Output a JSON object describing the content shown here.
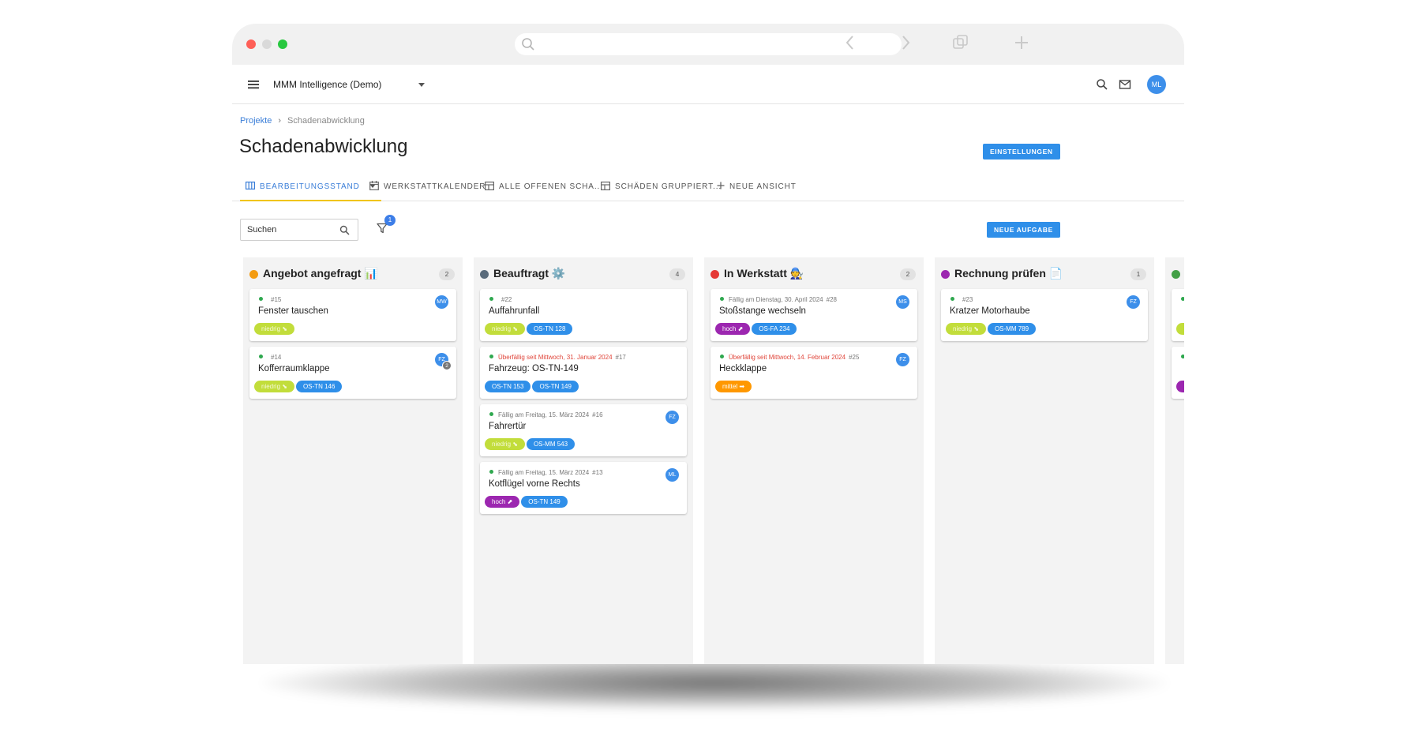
{
  "header": {
    "org_name": "MMM Intelligence (Demo)",
    "user_initials": "ML"
  },
  "breadcrumb": {
    "root": "Projekte",
    "separator": "›",
    "current": "Schadenabwicklung"
  },
  "page": {
    "title": "Schadenabwicklung",
    "settings_button": "EINSTELLUNGEN",
    "new_task_button": "NEUE AUFGABE"
  },
  "tabs": [
    {
      "label": "BEARBEITUNGSSTAND",
      "icon": "board-icon",
      "active": true
    },
    {
      "label": "WERKSTATTKALENDER",
      "icon": "calendar-icon",
      "active": false
    },
    {
      "label": "ALLE OFFENEN SCHA...",
      "icon": "table-icon",
      "active": false
    },
    {
      "label": "SCHÄDEN GRUPPIERT...",
      "icon": "table-icon",
      "active": false
    },
    {
      "label": "NEUE ANSICHT",
      "icon": "plus-icon",
      "active": false
    }
  ],
  "toolbar": {
    "search_placeholder": "Suchen",
    "filter_count": "1"
  },
  "colors": {
    "accent": "#2f8fe9",
    "tab_underline": "#f1c40f",
    "tag_low": "#c2dd3b",
    "tag_high": "#9c27b0",
    "tag_mid": "#ff9800",
    "tag_plate": "#2f8fe9"
  },
  "columns": [
    {
      "title": "Angebot angefragt 📊",
      "color": "#f39c12",
      "count": "2",
      "cards": [
        {
          "meta": "",
          "number": "#15",
          "title": "Fenster tauschen",
          "assignee": "MW",
          "tags": [
            {
              "label": "niedrig ⬊",
              "kind": "low"
            }
          ]
        },
        {
          "meta": "",
          "number": "#14",
          "title": "Kofferraumklappe",
          "assignee": "FZ",
          "extra": "2",
          "tags": [
            {
              "label": "niedrig ⬊",
              "kind": "low"
            },
            {
              "label": "OS-TN 146",
              "kind": "plate"
            }
          ]
        }
      ]
    },
    {
      "title": "Beauftragt ⚙️",
      "color": "#5a6b7b",
      "count": "4",
      "cards": [
        {
          "meta": "",
          "number": "#22",
          "title": "Auffahrunfall",
          "tags": [
            {
              "label": "niedrig ⬊",
              "kind": "low"
            },
            {
              "label": "OS-TN 128",
              "kind": "plate"
            }
          ]
        },
        {
          "meta": "Überfällig seit Mittwoch, 31. Januar 2024",
          "overdue": true,
          "number": "#17",
          "title": "Fahrzeug: OS-TN-149",
          "tags": [
            {
              "label": "OS-TN 153",
              "kind": "plate"
            },
            {
              "label": "OS-TN 149",
              "kind": "plate"
            }
          ]
        },
        {
          "meta": "Fällig am Freitag, 15. März 2024",
          "number": "#16",
          "title": "Fahrertür",
          "assignee": "FZ",
          "tags": [
            {
              "label": "niedrig ⬊",
              "kind": "low"
            },
            {
              "label": "OS-MM 543",
              "kind": "plate"
            }
          ]
        },
        {
          "meta": "Fällig am Freitag, 15. März 2024",
          "number": "#13",
          "title": "Kotflügel vorne Rechts",
          "assignee": "ML",
          "tags": [
            {
              "label": "hoch ⬈",
              "kind": "high"
            },
            {
              "label": "OS-TN 149",
              "kind": "plate"
            }
          ]
        }
      ]
    },
    {
      "title": "In Werkstatt 🧑‍🔧",
      "color": "#e53935",
      "count": "2",
      "cards": [
        {
          "meta": "Fällig am Dienstag, 30. April 2024",
          "number": "#28",
          "title": "Stoßstange wechseln",
          "assignee": "MS",
          "tags": [
            {
              "label": "hoch ⬈",
              "kind": "high"
            },
            {
              "label": "OS-FA 234",
              "kind": "plate"
            }
          ]
        },
        {
          "meta": "Überfällig seit Mittwoch, 14. Februar 2024",
          "overdue": true,
          "number": "#25",
          "title": "Heckklappe",
          "assignee": "FZ",
          "tags": [
            {
              "label": "mittel ➡",
              "kind": "mid"
            }
          ]
        }
      ]
    },
    {
      "title": "Rechnung prüfen 📄",
      "color": "#9c27b0",
      "count": "1",
      "cards": [
        {
          "meta": "",
          "number": "#23",
          "title": "Kratzer Motorhaube",
          "assignee": "FZ",
          "tags": [
            {
              "label": "niedrig ⬊",
              "kind": "low"
            },
            {
              "label": "OS-MM 789",
              "kind": "plate"
            }
          ]
        }
      ]
    },
    {
      "title": "",
      "color": "#43a047",
      "count": "",
      "cards": [
        {
          "meta": "",
          "number": "",
          "title": "",
          "tags": [
            {
              "label": "",
              "kind": "low"
            }
          ]
        },
        {
          "meta": "",
          "number": "",
          "title": "",
          "tags": [
            {
              "label": "",
              "kind": "high"
            }
          ]
        }
      ]
    }
  ]
}
